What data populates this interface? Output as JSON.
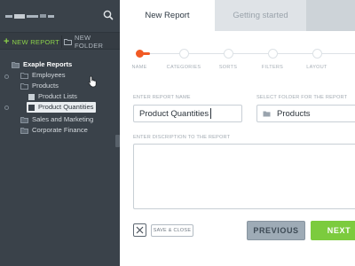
{
  "sidebar": {
    "logo": "logo",
    "search_icon": "search-icon",
    "new_report_label": "NEW REPORT",
    "new_folder_label": "NEW FOLDER",
    "tree": [
      {
        "label": "Exaple Reports",
        "icon": "folder-icon",
        "level": 0
      },
      {
        "label": "Employees",
        "icon": "folder-icon",
        "level": 1
      },
      {
        "label": "Products",
        "icon": "folder-icon",
        "level": 1
      },
      {
        "label": "Product Lists",
        "icon": "report-icon",
        "level": 2
      },
      {
        "label": "Product Quantities",
        "icon": "report-icon",
        "level": 2,
        "selected": true
      },
      {
        "label": "Sales and Marketing",
        "icon": "folder-icon",
        "level": 1
      },
      {
        "label": "Corporate Finance",
        "icon": "folder-icon",
        "level": 1
      }
    ]
  },
  "tabs": [
    {
      "label": "New Report",
      "active": true
    },
    {
      "label": "Getting started",
      "active": false
    }
  ],
  "wizard": {
    "steps": [
      "NAME",
      "CATEGORIES",
      "SORTS",
      "FILTERS",
      "LAYOUT",
      "O"
    ],
    "current_step": 0
  },
  "form": {
    "name_label": "ENTER REPORT NAME",
    "name_value": "Product Quantities",
    "folder_label": "SELECT FOLDER FOR THE REPORT",
    "folder_value": "Products",
    "description_label": "ENTER DISCRIPTION TO THE REPORT",
    "description_value": ""
  },
  "buttons": {
    "save_close": "SAVE & CLOSE",
    "previous": "PREVIOUS",
    "next": "NEXT"
  },
  "colors": {
    "sidebar_bg": "#3a424a",
    "accent_green": "#7ccb3e",
    "accent_orange": "#f15a24",
    "selected_bg": "#e9edf0"
  }
}
